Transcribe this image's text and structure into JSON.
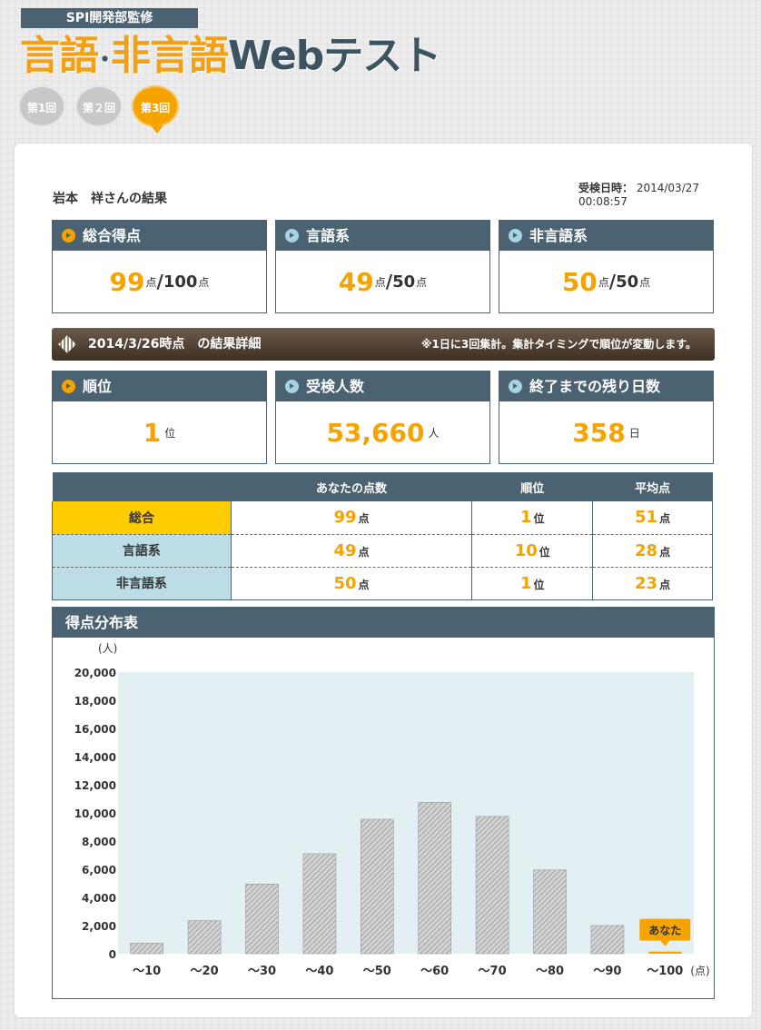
{
  "header": {
    "supervise": "SPI開発部監修",
    "logo_part1": "言語",
    "logo_dot": "･",
    "logo_part2": "非言語",
    "logo_part3": "Webテスト",
    "rounds": [
      {
        "label": "第1回",
        "active": false
      },
      {
        "label": "第２回",
        "active": false
      },
      {
        "label": "第3回",
        "active": true
      }
    ]
  },
  "result": {
    "name_label": "岩本　祥さんの結果",
    "exam_time_label": "受検日時：",
    "exam_date": "2014/03/27",
    "exam_time": "00:08:57"
  },
  "score_boxes": [
    {
      "title": "総合得点",
      "bullet": "gold",
      "value": "99",
      "unit": "点",
      "slash": "/",
      "max": "100",
      "max_unit": "点"
    },
    {
      "title": "言語系",
      "bullet": "blue",
      "value": "49",
      "unit": "点",
      "slash": "/",
      "max": "50",
      "max_unit": "点"
    },
    {
      "title": "非言語系",
      "bullet": "blue",
      "value": "50",
      "unit": "点",
      "slash": "/",
      "max": "50",
      "max_unit": "点"
    }
  ],
  "detail": {
    "title": "2014/3/26時点　の結果詳細",
    "note": "※1日に3回集計。集計タイミングで順位が変動します。"
  },
  "stat_boxes": [
    {
      "title": "順位",
      "bullet": "gold",
      "value": "1",
      "unit": "位"
    },
    {
      "title": "受検人数",
      "bullet": "blue",
      "value": "53,660",
      "unit": "人"
    },
    {
      "title": "終了までの残り日数",
      "bullet": "blue",
      "value": "358",
      "unit": "日"
    }
  ],
  "table": {
    "headers": [
      "",
      "あなたの点数",
      "順位",
      "平均点"
    ],
    "rows": [
      {
        "label": "総合",
        "score": "99",
        "score_unit": "点",
        "rank": "1",
        "rank_unit": "位",
        "avg": "51",
        "avg_unit": "点"
      },
      {
        "label": "言語系",
        "score": "49",
        "score_unit": "点",
        "rank": "10",
        "rank_unit": "位",
        "avg": "28",
        "avg_unit": "点"
      },
      {
        "label": "非言語系",
        "score": "50",
        "score_unit": "点",
        "rank": "1",
        "rank_unit": "位",
        "avg": "23",
        "avg_unit": "点"
      }
    ]
  },
  "chart_panel_title": "得点分布表",
  "chart_data": {
    "type": "bar",
    "ylabel": "(人)",
    "xunit": "(点)",
    "ylim": [
      0,
      20000
    ],
    "yticks": [
      "0",
      "2,000",
      "4,000",
      "6,000",
      "8,000",
      "10,000",
      "12,000",
      "14,000",
      "16,000",
      "18,000",
      "20,000"
    ],
    "categories": [
      "〜10",
      "〜20",
      "〜30",
      "〜40",
      "〜50",
      "〜60",
      "〜70",
      "〜80",
      "〜90",
      "〜100"
    ],
    "values": [
      750,
      2350,
      4950,
      7100,
      9550,
      10750,
      9750,
      5950,
      2000,
      150
    ],
    "highlight_index": 9,
    "highlight_label": "あなた",
    "colors": {
      "bar": "#bdbdbd",
      "highlight": "#f5a300",
      "plot_bg": "#e2f0f4"
    }
  },
  "colors": {
    "accent": "#f5a300",
    "navy": "#4a6272",
    "light_blue": "#bcdde5",
    "yellow": "#ffcc00"
  }
}
